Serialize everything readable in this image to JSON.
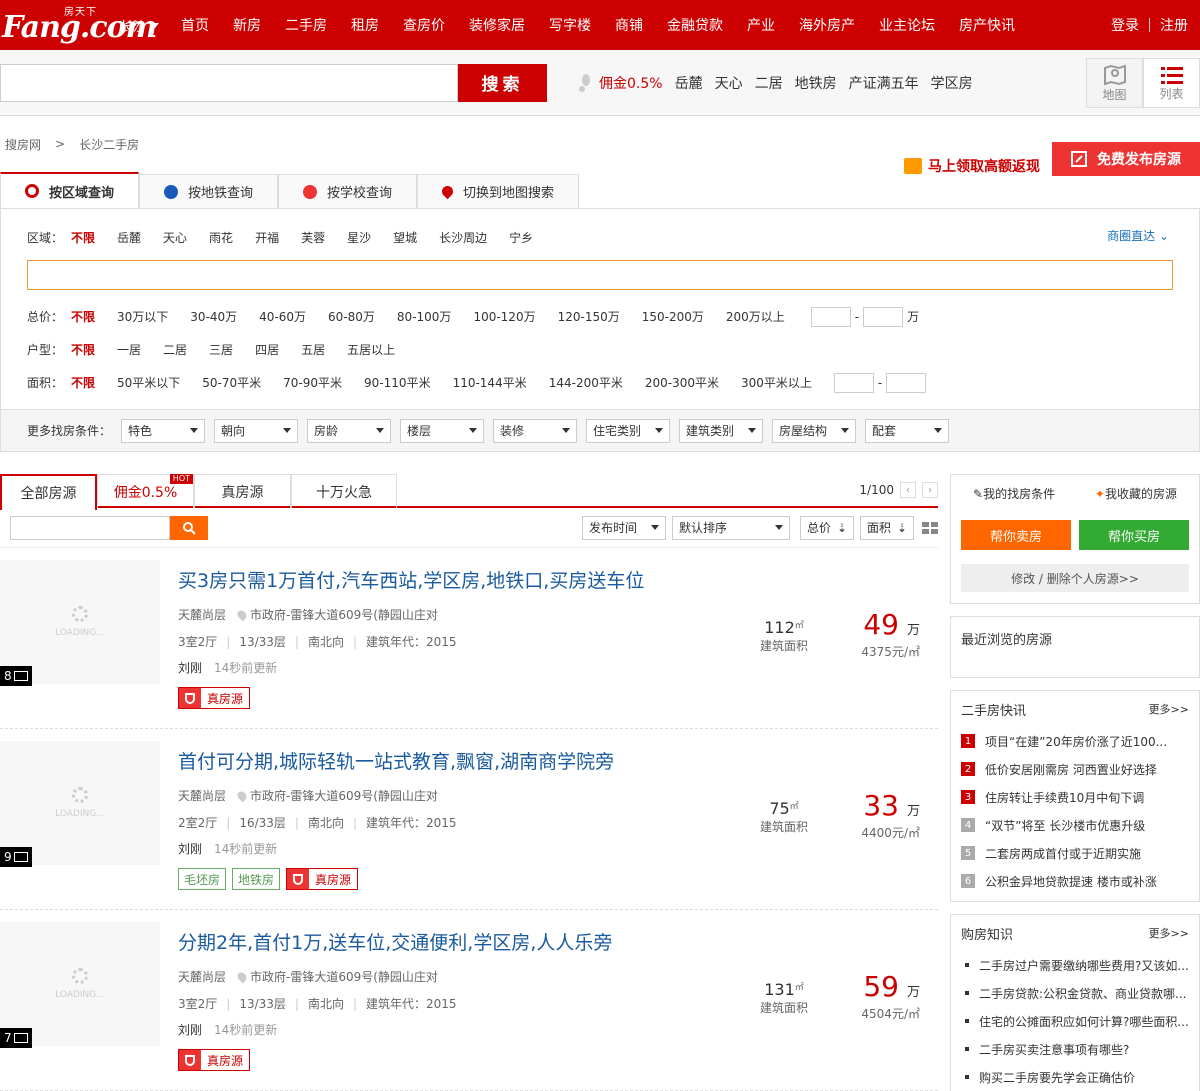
{
  "header": {
    "logo_main": "Fang.com",
    "logo_sub": "房天下",
    "city": "长沙",
    "nav": [
      "首页",
      "新房",
      "二手房",
      "租房",
      "查房价",
      "装修家居",
      "写字楼",
      "商铺",
      "金融贷款",
      "产业",
      "海外房产",
      "业主论坛",
      "房产快讯"
    ],
    "login": "登录",
    "register": "注册"
  },
  "search": {
    "placeholder": "",
    "button": "搜索",
    "hot_red": "佣金0.5%",
    "hot": [
      "岳麓",
      "天心",
      "二居",
      "地铁房",
      "产证满五年",
      "学区房"
    ],
    "map_label": "地图",
    "list_label": "列表"
  },
  "breadcrumb": [
    "搜房网",
    "长沙二手房"
  ],
  "breadcrumb_sep": ">",
  "promo": "马上领取高额返现",
  "publish": "免费发布房源",
  "query_tabs": [
    "按区域查询",
    "按地铁查询",
    "按学校查询",
    "切换到地图搜索"
  ],
  "filters": {
    "district_label": "区域：",
    "districts": [
      "不限",
      "岳麓",
      "天心",
      "雨花",
      "开福",
      "芙蓉",
      "星沙",
      "望城",
      "长沙周边",
      "宁乡"
    ],
    "shangquan": "商圈直达",
    "price_label": "总价：",
    "prices": [
      "不限",
      "30万以下",
      "30-40万",
      "40-60万",
      "60-80万",
      "80-100万",
      "100-120万",
      "120-150万",
      "150-200万",
      "200万以上"
    ],
    "price_unit": "万",
    "range_sep": "-",
    "room_label": "户型：",
    "rooms": [
      "不限",
      "一居",
      "二居",
      "三居",
      "四居",
      "五居",
      "五居以上"
    ],
    "area_label": "面积：",
    "areas": [
      "不限",
      "50平米以下",
      "50-70平米",
      "70-90平米",
      "90-110平米",
      "110-144平米",
      "144-200平米",
      "200-300平米",
      "300平米以上"
    ],
    "more_label": "更多找房条件：",
    "more": [
      "特色",
      "朝向",
      "房龄",
      "楼层",
      "装修",
      "住宅类别",
      "建筑类别",
      "房屋结构",
      "配套"
    ]
  },
  "list_tabs": [
    "全部房源",
    "佣金0.5%",
    "真房源",
    "十万火急"
  ],
  "hot_badge": "HOT",
  "pager": "1/100",
  "sorts": [
    "发布时间",
    "默认排序",
    "总价",
    "面积"
  ],
  "listings": [
    {
      "title": "买3房只需1万首付,汽车西站,学区房,地铁口,买房送车位",
      "estate": "天麓尚层",
      "address": "市政府-雷锋大道609号(静园山庄对",
      "layout": "3室2厅",
      "floor": "13/33层",
      "orient": "南北向",
      "year": "建筑年代：2015",
      "agent": "刘刚",
      "updated": "14秒前更新",
      "tags": [],
      "zhen": "真房源",
      "area": "112",
      "area_unit": "㎡",
      "area_label": "建筑面积",
      "price": "49",
      "price_unit": "万",
      "unit_price": "4375元/㎡",
      "photos": "8"
    },
    {
      "title": "首付可分期,城际轻轨一站式教育,飘窗,湖南商学院旁",
      "estate": "天麓尚层",
      "address": "市政府-雷锋大道609号(静园山庄对",
      "layout": "2室2厅",
      "floor": "16/33层",
      "orient": "南北向",
      "year": "建筑年代：2015",
      "agent": "刘刚",
      "updated": "14秒前更新",
      "tags": [
        "毛坯房",
        "地铁房"
      ],
      "zhen": "真房源",
      "area": "75",
      "area_unit": "㎡",
      "area_label": "建筑面积",
      "price": "33",
      "price_unit": "万",
      "unit_price": "4400元/㎡",
      "photos": "9"
    },
    {
      "title": "分期2年,首付1万,送车位,交通便利,学区房,人人乐旁",
      "estate": "天麓尚层",
      "address": "市政府-雷锋大道609号(静园山庄对",
      "layout": "3室2厅",
      "floor": "13/33层",
      "orient": "南北向",
      "year": "建筑年代：2015",
      "agent": "刘刚",
      "updated": "14秒前更新",
      "tags": [],
      "zhen": "真房源",
      "area": "131",
      "area_unit": "㎡",
      "area_label": "建筑面积",
      "price": "59",
      "price_unit": "万",
      "unit_price": "4504元/㎡",
      "photos": "7"
    }
  ],
  "loading": "LOADING...",
  "sidebar": {
    "my_conditions": "我的找房条件",
    "my_favorites": "我收藏的房源",
    "sell": "帮你卖房",
    "buy": "帮你买房",
    "modify": "修改 / 删除个人房源>>",
    "recent": "最近浏览的房源",
    "news_title": "二手房快讯",
    "more": "更多>>",
    "news": [
      "项目“在建”20年房价涨了近100...",
      "低价安居刚需房 河西置业好选择",
      "住房转让手续费10月中旬下调",
      "“双节”将至 长沙楼市优惠升级",
      "二套房两成首付或于近期实施",
      "公积金异地贷款提速 楼市或补涨"
    ],
    "know_title": "购房知识",
    "know": [
      "二手房过户需要缴纳哪些费用?又该如...",
      "二手房贷款:公积金贷款、商业贷款哪...",
      "住宅的公摊面积应如何计算?哪些面积...",
      "二手房买卖注意事项有哪些?",
      "购买二手房要先学会正确估价"
    ]
  },
  "colors": {
    "brand": "#cc0000",
    "orange": "#ff6600",
    "green": "#33aa33"
  }
}
